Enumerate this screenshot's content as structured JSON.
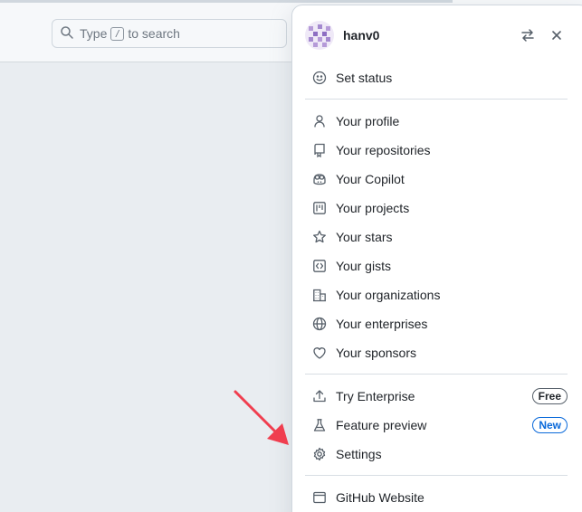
{
  "search": {
    "prefix": "Type",
    "key": "/",
    "suffix": "to search"
  },
  "menu": {
    "username": "hanv0",
    "status_label": "Set status",
    "items": [
      {
        "label": "Your profile",
        "icon": "person-icon"
      },
      {
        "label": "Your repositories",
        "icon": "repo-icon"
      },
      {
        "label": "Your Copilot",
        "icon": "copilot-icon"
      },
      {
        "label": "Your projects",
        "icon": "project-icon"
      },
      {
        "label": "Your stars",
        "icon": "star-icon"
      },
      {
        "label": "Your gists",
        "icon": "code-square-icon"
      },
      {
        "label": "Your organizations",
        "icon": "organization-icon"
      },
      {
        "label": "Your enterprises",
        "icon": "globe-icon"
      },
      {
        "label": "Your sponsors",
        "icon": "heart-icon"
      }
    ],
    "try_enterprise": {
      "label": "Try Enterprise",
      "badge": "Free"
    },
    "feature_preview": {
      "label": "Feature preview",
      "badge": "New"
    },
    "settings_label": "Settings",
    "github_website_label": "GitHub Website"
  },
  "colors": {
    "accent": "#0969da",
    "arrow": "#f03e4f"
  }
}
